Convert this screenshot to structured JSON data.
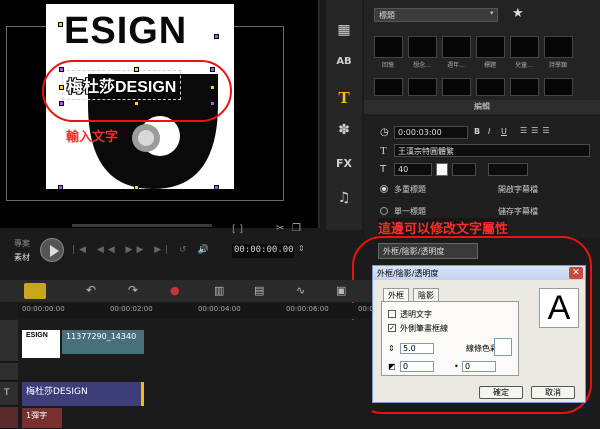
{
  "preview": {
    "logo_text": "ESIGN",
    "title_overlay": "梅杜莎DESIGN",
    "hint_input": "輸入文字",
    "mode_project": "專案",
    "mode_clip": "素材",
    "timecode": "00:00:00.00",
    "bracket_controls": "[ ]"
  },
  "library": {
    "category": "標題",
    "thumbnails": [
      "回憶",
      "想念...",
      "週年...",
      "標題",
      "兒童...",
      "詩學類"
    ]
  },
  "options": {
    "section_label": "編輯",
    "duration": "0:00:03:00",
    "font": "王漢宗特圓體繁",
    "font_size": "40",
    "multi_title": "多重標題",
    "single_title": "單一標題",
    "open_title_file": "開啟字幕檔",
    "save_title_file": "儲存字幕檔"
  },
  "hint_edit": "這邊可以修改文字屬性",
  "border_button": "外框/陰影/透明度",
  "dialog": {
    "title": "外框/陰影/透明度",
    "tab_border": "外框",
    "tab_shadow": "陰影",
    "transparent_text": "透明文字",
    "outer_border": "外側筆畫框線",
    "border_width": "5.0",
    "line_color": "線條色彩:",
    "value_a": "0",
    "value_b": "0",
    "preview_letter": "A",
    "ok": "確定",
    "cancel": "取消"
  },
  "timeline": {
    "ruler": [
      "00:00:00:00",
      "00:00:02:00",
      "00:00:04:00",
      "00:00:06:00",
      "00:00:08:00"
    ],
    "video_clip": "11377290_14340",
    "title_clip": "梅杜莎DESIGN",
    "voice_clip": "1彈字",
    "thumb_logo": "ESIGN"
  },
  "colors": {
    "annotation_red": "#e11111",
    "title_track": "#3d3d7a",
    "video_clip": "#496f7c",
    "handle_yellow": "#ffd200"
  }
}
